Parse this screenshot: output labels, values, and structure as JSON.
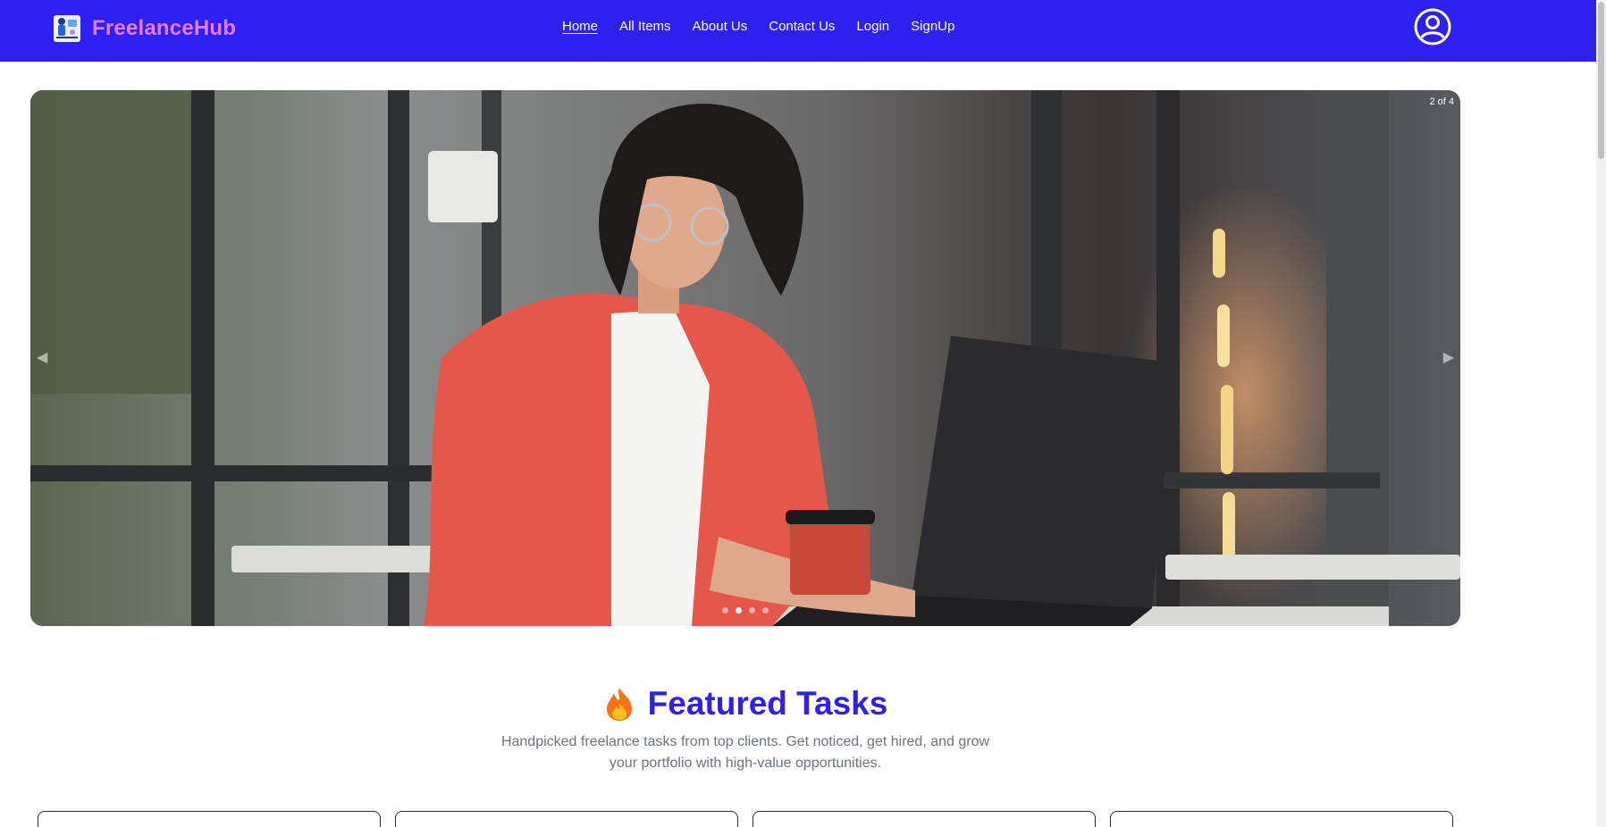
{
  "brand": {
    "name": "FreelanceHub",
    "logo_icon": "freelancer-logo-icon"
  },
  "nav": {
    "items": [
      {
        "label": "Home",
        "active": true
      },
      {
        "label": "All Items",
        "active": false
      },
      {
        "label": "About Us",
        "active": false
      },
      {
        "label": "Contact Us",
        "active": false
      },
      {
        "label": "Login",
        "active": false
      },
      {
        "label": "SignUp",
        "active": false
      }
    ],
    "profile_icon": "user-circle-icon"
  },
  "hero": {
    "slide_counter": "2 of 4",
    "prev_arrow": "◀",
    "next_arrow": "▶",
    "current_slide": 2,
    "total_slides": 4
  },
  "featured": {
    "icon": "fire-icon",
    "title": "Featured Tasks",
    "subtitle": "Handpicked freelance tasks from top clients. Get noticed, get hired, and grow your portfolio with high-value opportunities."
  },
  "colors": {
    "navbar": "#2e20f0",
    "brand": "#e879f9",
    "heading": "#2e20f0",
    "subtitle": "#6b7280"
  }
}
